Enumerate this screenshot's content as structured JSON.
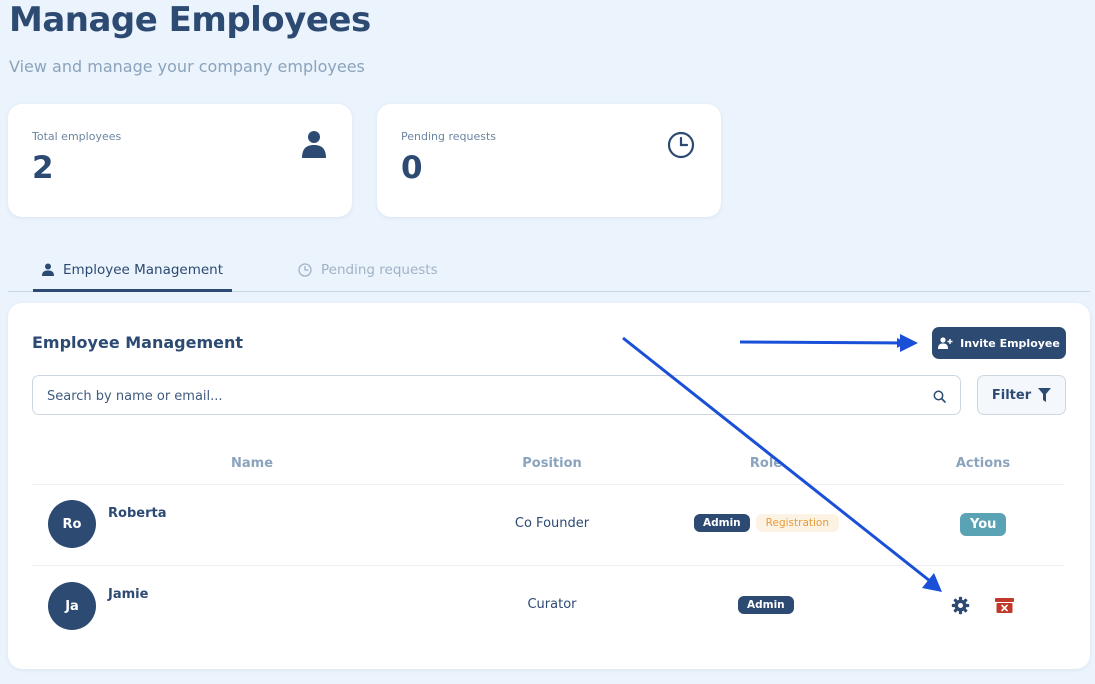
{
  "header": {
    "title": "Manage Employees",
    "subtitle": "View and manage your company employees"
  },
  "stats": [
    {
      "label": "Total employees",
      "value": "2",
      "icon": "user-icon"
    },
    {
      "label": "Pending requests",
      "value": "0",
      "icon": "clock-icon"
    }
  ],
  "tabs": [
    {
      "label": "Employee Management",
      "icon": "user-icon",
      "active": true
    },
    {
      "label": "Pending requests",
      "icon": "clock-icon",
      "active": false
    }
  ],
  "panel": {
    "title": "Employee Management",
    "invite_label": "Invite Employee",
    "search_placeholder": "Search by name or email...",
    "filter_label": "Filter"
  },
  "table": {
    "columns": [
      "Name",
      "Position",
      "Role",
      "Actions"
    ],
    "rows": [
      {
        "initials": "Ro",
        "name": "Roberta",
        "position": "Co Founder",
        "roles": [
          "Admin",
          "Registration"
        ],
        "action": "You"
      },
      {
        "initials": "Ja",
        "name": "Jamie",
        "position": "Curator",
        "roles": [
          "Admin"
        ],
        "action": "icons"
      }
    ]
  },
  "colors": {
    "background": "#ebf3fc",
    "primary": "#2c4a72",
    "muted": "#8ba3bd",
    "you_badge": "#5aa3b4",
    "registration_text": "#e79a3c",
    "registration_bg": "#fdf3e4",
    "delete_icon": "#c0392b",
    "annotation_arrow": "#1a4fd8"
  }
}
